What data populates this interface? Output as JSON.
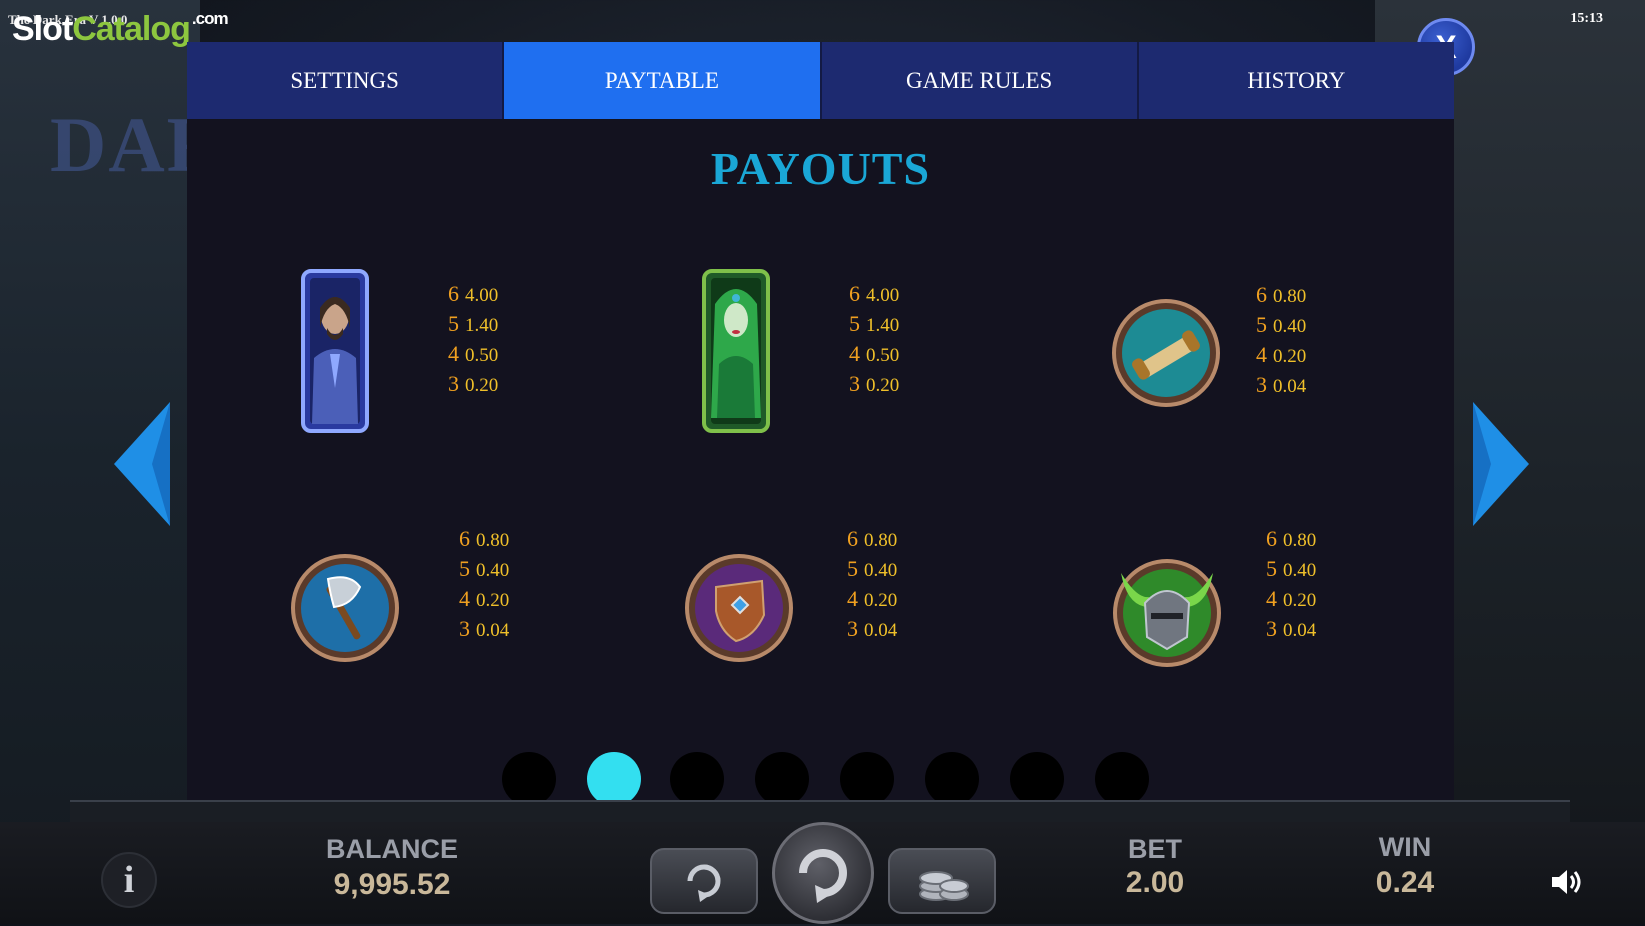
{
  "header": {
    "game_version": "The Dark Era  V 1.0.0",
    "watermark": {
      "part1": "Slot",
      "part2": "Catalog",
      "suffix": ".com"
    },
    "clock": "15:13",
    "background_logo": "DARK"
  },
  "modal": {
    "close_label": "X",
    "tabs": [
      {
        "label": "SETTINGS",
        "active": false
      },
      {
        "label": "PAYTABLE",
        "active": true
      },
      {
        "label": "GAME RULES",
        "active": false
      },
      {
        "label": "HISTORY",
        "active": false
      }
    ],
    "title": "PAYOUTS",
    "symbols": [
      {
        "icon": "warrior-man-icon",
        "pays": [
          {
            "count": "6",
            "value": "4.00"
          },
          {
            "count": "5",
            "value": "1.40"
          },
          {
            "count": "4",
            "value": "0.50"
          },
          {
            "count": "3",
            "value": "0.20"
          }
        ]
      },
      {
        "icon": "green-sorceress-icon",
        "pays": [
          {
            "count": "6",
            "value": "4.00"
          },
          {
            "count": "5",
            "value": "1.40"
          },
          {
            "count": "4",
            "value": "0.50"
          },
          {
            "count": "3",
            "value": "0.20"
          }
        ]
      },
      {
        "icon": "scroll-map-icon",
        "pays": [
          {
            "count": "6",
            "value": "0.80"
          },
          {
            "count": "5",
            "value": "0.40"
          },
          {
            "count": "4",
            "value": "0.20"
          },
          {
            "count": "3",
            "value": "0.04"
          }
        ]
      },
      {
        "icon": "axe-icon",
        "pays": [
          {
            "count": "6",
            "value": "0.80"
          },
          {
            "count": "5",
            "value": "0.40"
          },
          {
            "count": "4",
            "value": "0.20"
          },
          {
            "count": "3",
            "value": "0.04"
          }
        ]
      },
      {
        "icon": "shield-icon",
        "pays": [
          {
            "count": "6",
            "value": "0.80"
          },
          {
            "count": "5",
            "value": "0.40"
          },
          {
            "count": "4",
            "value": "0.20"
          },
          {
            "count": "3",
            "value": "0.04"
          }
        ]
      },
      {
        "icon": "horned-helmet-icon",
        "pays": [
          {
            "count": "6",
            "value": "0.80"
          },
          {
            "count": "5",
            "value": "0.40"
          },
          {
            "count": "4",
            "value": "0.20"
          },
          {
            "count": "3",
            "value": "0.04"
          }
        ]
      }
    ],
    "pagination": {
      "pages": 8,
      "current": 2
    }
  },
  "bottom_bar": {
    "balance_label": "BALANCE",
    "balance_value": "9,995.52",
    "bet_label": "BET",
    "bet_value": "2.00",
    "win_label": "WIN",
    "win_value": "0.24",
    "info_label": "i"
  },
  "colors": {
    "tab_active": "#1f6ff0",
    "tab_inactive": "#1d2a70",
    "title": "#1aa7d6",
    "pay_count": "#f0a020",
    "pay_value": "#f0c02a",
    "dot_active": "#33dff0"
  }
}
